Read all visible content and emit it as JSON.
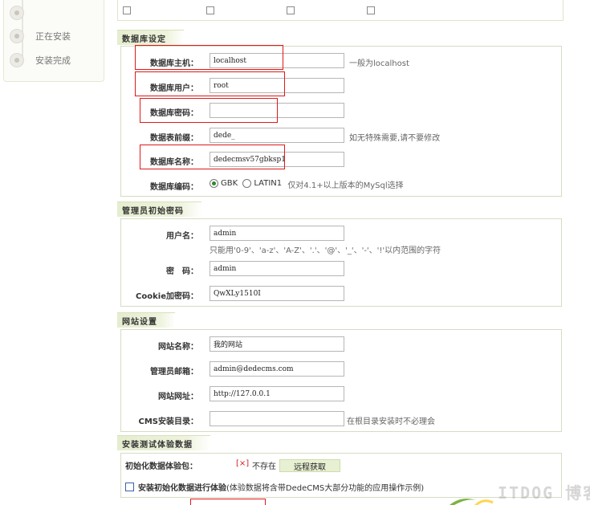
{
  "steps": [
    {
      "label": "",
      "state": "active"
    },
    {
      "label": "正在安装",
      "state": "pending"
    },
    {
      "label": "安装完成",
      "state": "pending"
    }
  ],
  "modules_partial": [
    {
      "label": ""
    },
    {
      "label": ""
    },
    {
      "label": ""
    },
    {
      "label": ""
    }
  ],
  "db": {
    "section_title": "数据库设定",
    "host_label": "数据库主机：",
    "host_value": "localhost",
    "host_hint": "一般为localhost",
    "user_label": "数据库用户：",
    "user_value": "root",
    "pwd_label": "数据库密码：",
    "pwd_value": "",
    "prefix_label": "数据表前缀：",
    "prefix_value": "dede_",
    "prefix_hint": "如无特殊需要,请不要修改",
    "name_label": "数据库名称：",
    "name_value": "dedecmsv57gbksp1",
    "charset_label": "数据库编码：",
    "charset_gbk": "GBK",
    "charset_latin": "LATIN1",
    "charset_hint": "仅对4.1+以上版本的MySql选择"
  },
  "admin": {
    "section_title": "管理员初始密码",
    "user_label": "用户名：",
    "user_value": "admin",
    "user_hint": "只能用'0-9'、'a-z'、'A-Z'、'.'、'@'、'_'、'-'、'!'以内范围的字符",
    "pwd_label": "密　码：",
    "pwd_value": "admin",
    "cookie_label": "Cookie加密码：",
    "cookie_value": "QwXLy1510I"
  },
  "site": {
    "section_title": "网站设置",
    "name_label": "网站名称：",
    "name_value": "我的网站",
    "email_label": "管理员邮箱：",
    "email_value": "admin@dedecms.com",
    "url_label": "网站网址：",
    "url_value": "http://127.0.0.1",
    "dir_label": "CMS安装目录：",
    "dir_value": "",
    "dir_hint": "在根目录安装时不必理会"
  },
  "demo": {
    "section_title": "安装测试体验数据",
    "pkg_label": "初始化数据体验包：",
    "status_mark": "[×]",
    "status_text": "不存在",
    "fetch_label": "远程获取",
    "install_label": "安装初始化数据进行体验",
    "install_note": "(体验数据将含带DedeCMS大部分功能的应用操作示例)"
  },
  "watermark": "ITDOG 博客",
  "colors": {
    "highlight": "#e01919",
    "section_bg": "#e5edcf",
    "active_step": "#e08a00",
    "error_mark": "#d22222"
  }
}
